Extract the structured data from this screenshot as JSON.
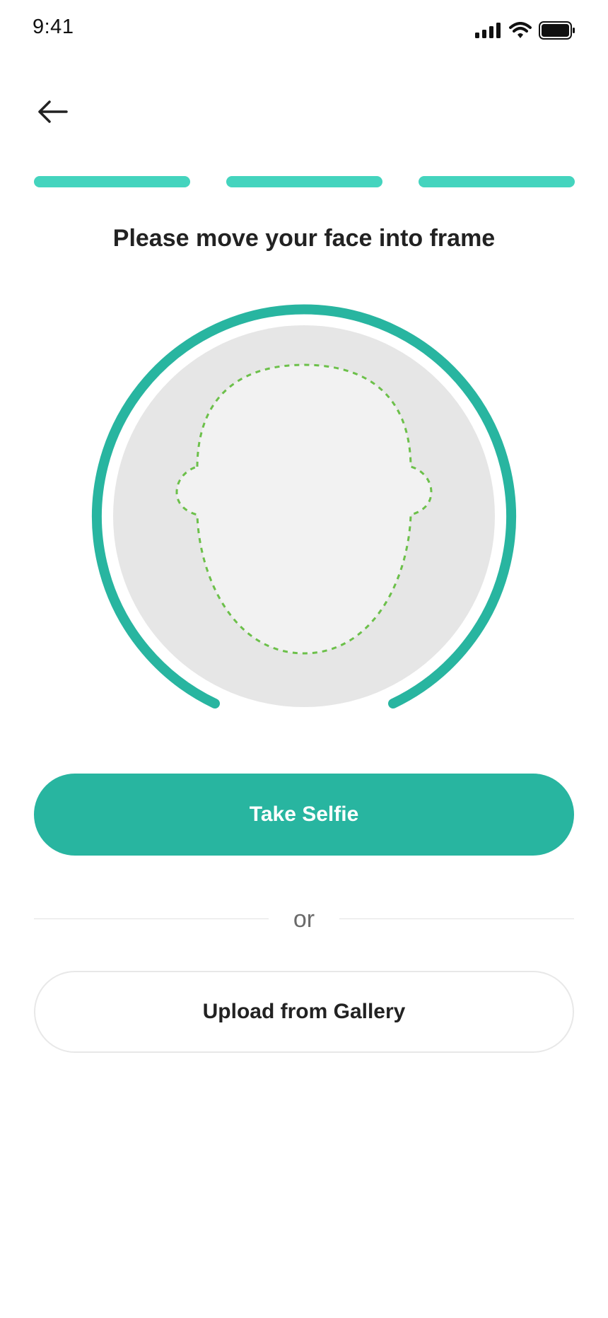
{
  "status_bar": {
    "time": "9:41",
    "icons": [
      "signal-icon",
      "wifi-icon",
      "battery-icon"
    ]
  },
  "header": {
    "back_icon": "arrow-left-icon"
  },
  "progress": {
    "steps_total": 3,
    "steps_completed": 3,
    "color": "#44d4be"
  },
  "instruction": "Please move your face into frame",
  "face_frame": {
    "ring_color": "#28b5a0",
    "background_color": "#e6e6e6",
    "guide_color": "#6cc04a",
    "icon": "face-outline-icon"
  },
  "actions": {
    "take_selfie_label": "Take Selfie",
    "divider_label": "or",
    "upload_label": "Upload from Gallery",
    "primary_color": "#28b5a0"
  }
}
